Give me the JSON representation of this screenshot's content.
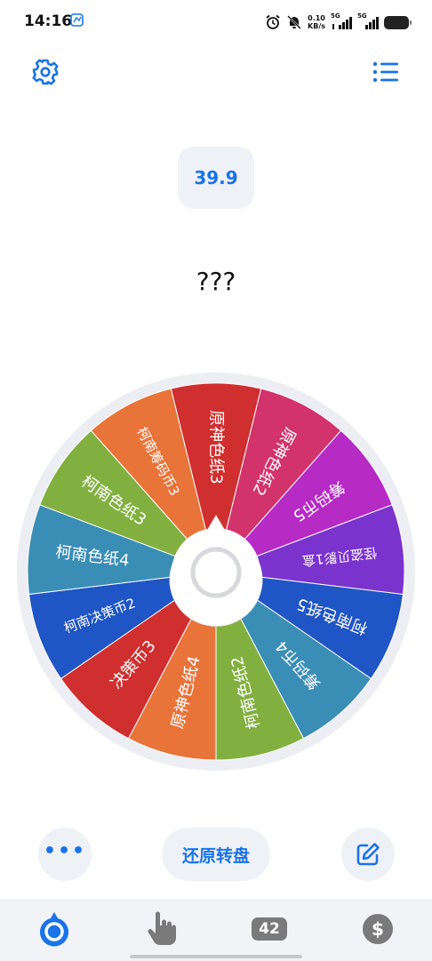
{
  "status_bar": {
    "time": "14:16",
    "net_speed_value": "0.10",
    "net_speed_unit": "KB/s",
    "signal1_label": "5G",
    "signal2_label": "5G"
  },
  "top_bar": {
    "settings_icon": "gear-icon",
    "menu_icon": "list-icon"
  },
  "value_badge": "39.9",
  "result_text": "???",
  "wheel": {
    "segments": [
      {
        "label": "原神色纸3",
        "color": "#d02f2f"
      },
      {
        "label": "原神色纸2",
        "color": "#d2336b"
      },
      {
        "label": "筹码币5",
        "color": "#b52bc4"
      },
      {
        "label": "怪盗贝影1盒",
        "color": "#7a33cc"
      },
      {
        "label": "柯南色纸5",
        "color": "#1f55c4"
      },
      {
        "label": "筹码币4",
        "color": "#3a8eb5"
      },
      {
        "label": "柯南色纸2",
        "color": "#82b040"
      },
      {
        "label": "原神色纸4",
        "color": "#e8743a"
      },
      {
        "label": "决策币3",
        "color": "#d02f2f"
      },
      {
        "label": "柯南决策币2",
        "color": "#1f55c4"
      },
      {
        "label": "柯南色纸4",
        "color": "#3a8eb5"
      },
      {
        "label": "柯南色纸3",
        "color": "#82b040"
      },
      {
        "label": "柯南筹码币3",
        "color": "#e8743a"
      }
    ]
  },
  "buttons": {
    "more_label": "•••",
    "reset_label": "还原转盘",
    "edit_icon": "edit-icon"
  },
  "bottom_nav": {
    "wheel_icon": "wheel-icon",
    "tap_icon": "hand-pointer-icon",
    "count_label": "42",
    "coin_label": "$"
  },
  "colors": {
    "accent": "#1a73e8",
    "button_bg": "#eef1f6",
    "nav_gray": "#7a7a7a"
  }
}
